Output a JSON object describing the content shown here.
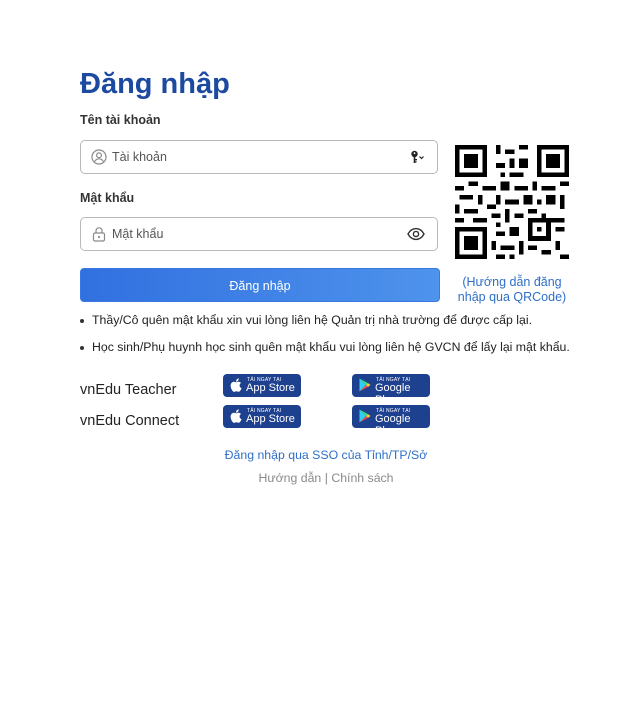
{
  "login": {
    "title": "Đăng nhập",
    "username_label": "Tên tài khoản",
    "username_placeholder": "Tài khoản",
    "password_label": "Mật khẩu",
    "password_placeholder": "Mật khẩu",
    "submit_label": "Đăng nhập"
  },
  "qr": {
    "guide_text": "(Hướng dẫn đăng nhập qua QRCode)"
  },
  "notes": [
    "Thầy/Cô quên mật khẩu xin vui lòng liên hệ Quản trị nhà trường để được cấp lại.",
    "Học sinh/Phụ huynh học sinh quên mật khẩu vui lòng liên hệ GVCN để lấy lại mật khẩu."
  ],
  "apps": [
    {
      "name": "vnEdu Teacher",
      "app_store": {
        "small": "TẢI NGAY TẠI",
        "big": "App Store"
      },
      "google_play": {
        "small": "TẢI NGAY TẠI",
        "big": "Google Play"
      }
    },
    {
      "name": "vnEdu Connect",
      "app_store": {
        "small": "TẢI NGAY TẠI",
        "big": "App Store"
      },
      "google_play": {
        "small": "TẢI NGAY TẠI",
        "big": "Google Play"
      }
    }
  ],
  "links": {
    "sso": "Đăng nhập qua SSO của Tỉnh/TP/Sở",
    "guide": "Hướng dẫn",
    "separator": "|",
    "policy": "Chính sách"
  },
  "icons": {
    "username": "user-circle-icon",
    "key": "key-icon",
    "password": "lock-icon",
    "toggle_visibility": "eye-icon",
    "apple": "apple-icon",
    "google_play": "google-play-icon"
  },
  "colors": {
    "title": "#1c4aa0",
    "primary_button": "#3170e0",
    "link": "#2f6fc7",
    "badge": "#1e418f"
  }
}
